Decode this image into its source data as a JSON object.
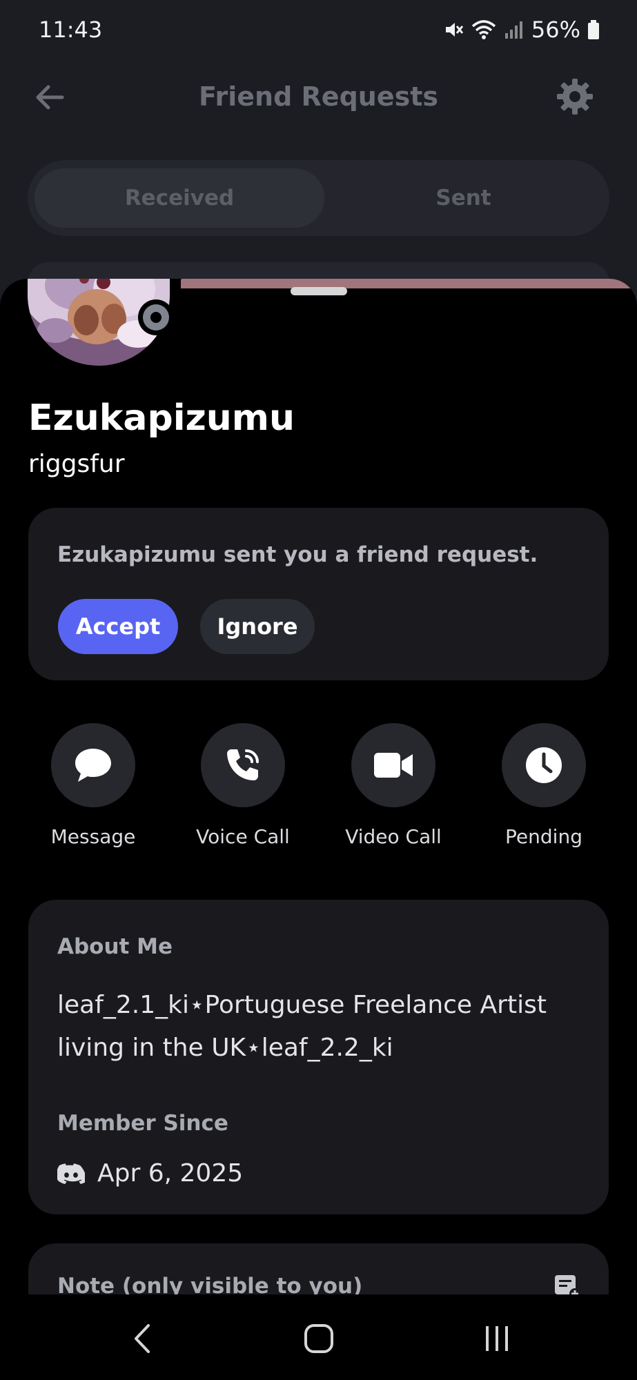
{
  "status_bar": {
    "time": "11:43",
    "battery": "56%"
  },
  "background": {
    "title": "Friend Requests",
    "tabs": [
      {
        "label": "Received",
        "active": true
      },
      {
        "label": "Sent",
        "active": false
      }
    ]
  },
  "profile": {
    "display_name": "Ezukapizumu",
    "username": "riggsfur",
    "banner_color": "#a0757c"
  },
  "friend_request": {
    "message": "Ezukapizumu sent you a friend request.",
    "accept_label": "Accept",
    "ignore_label": "Ignore"
  },
  "actions": [
    {
      "label": "Message",
      "icon": "chat-bubble-icon"
    },
    {
      "label": "Voice Call",
      "icon": "phone-icon"
    },
    {
      "label": "Video Call",
      "icon": "video-camera-icon"
    },
    {
      "label": "Pending",
      "icon": "clock-icon"
    }
  ],
  "about": {
    "title": "About Me",
    "text": "leaf_2.1_ki⋆Portuguese Freelance Artist living in the UK⋆leaf_2.2_ki",
    "member_since_title": "Member Since",
    "member_since_date": "Apr 6, 2025"
  },
  "note": {
    "title": "Note (only visible to you)"
  },
  "colors": {
    "accent": "#5865f2",
    "card": "#1a1a1e",
    "sheet": "#000000"
  }
}
